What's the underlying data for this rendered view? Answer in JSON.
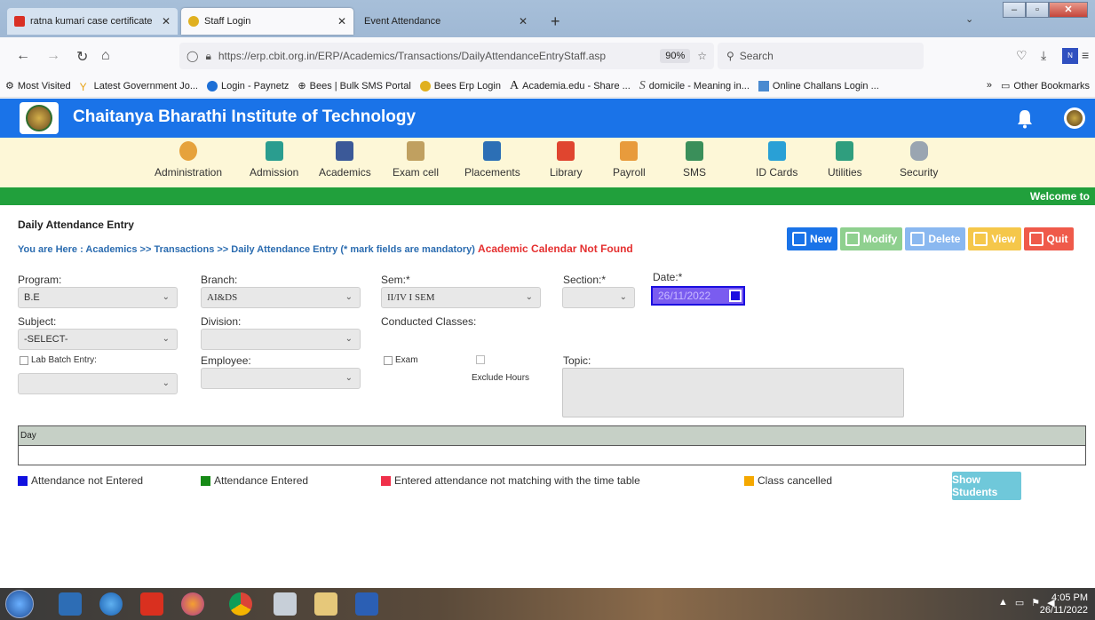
{
  "browser": {
    "tabs": [
      {
        "label": "ratna kumari case certificate - a",
        "active": false
      },
      {
        "label": "Staff Login",
        "active": true
      },
      {
        "label": "Event Attendance",
        "active": false
      }
    ],
    "url": "https://erp.cbit.org.in/ERP/Academics/Transactions/DailyAttendanceEntryStaff.asp",
    "zoom": "90%",
    "search_placeholder": "Search",
    "bookmarks": [
      {
        "label": "Most Visited"
      },
      {
        "label": "Latest Government Jo..."
      },
      {
        "label": "Login - Paynetz"
      },
      {
        "label": "Bees | Bulk SMS Portal"
      },
      {
        "label": "Bees Erp Login"
      },
      {
        "label": "Academia.edu - Share ..."
      },
      {
        "label": "domicile - Meaning in..."
      },
      {
        "label": "Online Challans Login ..."
      }
    ],
    "other_bookmarks": "Other Bookmarks",
    "more_bookmarks": "»"
  },
  "app": {
    "title": "Chaitanya Bharathi Institute of Technology",
    "welcome": "Welcome to",
    "modules": [
      {
        "label": "Administration",
        "color": "#e6a23c"
      },
      {
        "label": "Admission",
        "color": "#2a9d8f"
      },
      {
        "label": "Academics",
        "color": "#3b5998"
      },
      {
        "label": "Exam cell",
        "color": "#c0a060"
      },
      {
        "label": "Placements",
        "color": "#2c6fb5"
      },
      {
        "label": "Library",
        "color": "#e0452f"
      },
      {
        "label": "Payroll",
        "color": "#e89b3c"
      },
      {
        "label": "SMS",
        "color": "#3a8f5a"
      },
      {
        "label": "ID Cards",
        "color": "#29a0d6"
      },
      {
        "label": "Utilities",
        "color": "#2f9e7e"
      },
      {
        "label": "Security",
        "color": "#9aa5b1"
      }
    ]
  },
  "page": {
    "title": "Daily Attendance Entry",
    "breadcrumb": "You are Here : Academics >> Transactions >> Daily Attendance Entry (* mark fields are mandatory)",
    "warning": "Academic Calendar Not Found",
    "actions": [
      {
        "label": "New",
        "color": "#1a73e8"
      },
      {
        "label": "Modify",
        "color": "#8fd08f"
      },
      {
        "label": "Delete",
        "color": "#8ab8f0"
      },
      {
        "label": "View",
        "color": "#f5c74a"
      },
      {
        "label": "Quit",
        "color": "#ef5a4a"
      }
    ]
  },
  "form": {
    "program_label": "Program:",
    "program_value": "B.E",
    "branch_label": "Branch:",
    "branch_value": "AI&DS",
    "sem_label": "Sem:*",
    "sem_value": "II/IV I SEM",
    "section_label": "Section:*",
    "section_value": "",
    "date_label": "Date:*",
    "date_value": "26/11/2022",
    "subject_label": "Subject:",
    "subject_value": "-SELECT-",
    "division_label": "Division:",
    "division_value": "",
    "conducted_label": "Conducted Classes:",
    "lab_batch_label": "Lab Batch Entry:",
    "employee_label": "Employee:",
    "employee_value": "",
    "exam_label": "Exam",
    "exclude_label": "Exclude Hours",
    "topic_label": "Topic:",
    "day_header": "Day"
  },
  "legend": [
    {
      "label": "Attendance not Entered",
      "color": "#1010e0"
    },
    {
      "label": "Attendance Entered",
      "color": "#168a16"
    },
    {
      "label": "Entered attendance not matching with the time table",
      "color": "#f0304a"
    },
    {
      "label": "Class cancelled",
      "color": "#f5a800"
    }
  ],
  "show_students": "Show Students",
  "taskbar": {
    "time": "4:05 PM",
    "date": "26/11/2022"
  }
}
